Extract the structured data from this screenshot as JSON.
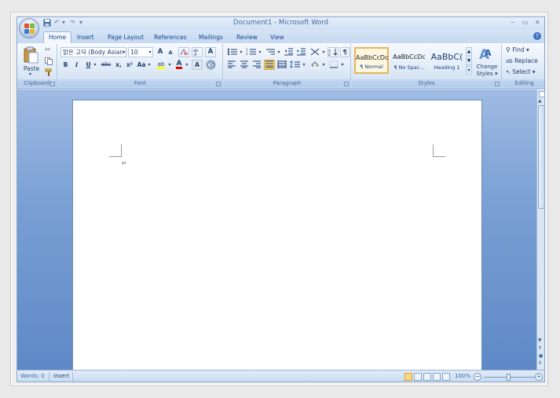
{
  "window": {
    "title": "Document1 - Microsoft Word"
  },
  "quick_access": {
    "undo": "↶",
    "redo": "↷",
    "more": "▾"
  },
  "window_controls": {
    "minimize": "–",
    "restore": "▭",
    "close": "✕"
  },
  "tabs": [
    {
      "label": "Home",
      "active": true
    },
    {
      "label": "Insert"
    },
    {
      "label": "Page Layout"
    },
    {
      "label": "References"
    },
    {
      "label": "Mailings"
    },
    {
      "label": "Review"
    },
    {
      "label": "View"
    }
  ],
  "help_label": "?",
  "clipboard": {
    "paste_label": "Paste",
    "group_label": "Clipboard"
  },
  "font": {
    "group_label": "Font",
    "font_name": "맑은 고딕 (Body Asian",
    "font_size": "10",
    "grow": "A",
    "shrink": "A",
    "clear": "A",
    "bold": "B",
    "italic": "I",
    "underline": "U",
    "strike": "abc",
    "subscript": "x,",
    "superscript": "x²",
    "change_case": "Aa",
    "highlight": "ab",
    "font_color": "A",
    "char_shade": "A"
  },
  "paragraph": {
    "group_label": "Paragraph"
  },
  "styles": {
    "group_label": "Styles",
    "tiles": [
      {
        "preview": "AaBbCcDc",
        "name": "¶ Normal",
        "selected": true
      },
      {
        "preview": "AaBbCcDc",
        "name": "¶ No Spac..."
      },
      {
        "preview": "AaBbC(",
        "name": "Heading 1"
      }
    ],
    "change_styles_line1": "Change",
    "change_styles_line2": "Styles ▾"
  },
  "editing": {
    "group_label": "Editing",
    "find": "Find ▾",
    "replace": "Replace",
    "select": "Select ▾"
  },
  "document": {
    "paragraph_mark": "↵"
  },
  "status": {
    "words": "Words: 0",
    "mode": "Insert",
    "zoom": "100%"
  },
  "colors": {
    "highlight": "#ffff00",
    "font_color": "#e00000",
    "accent": "#15428b"
  }
}
